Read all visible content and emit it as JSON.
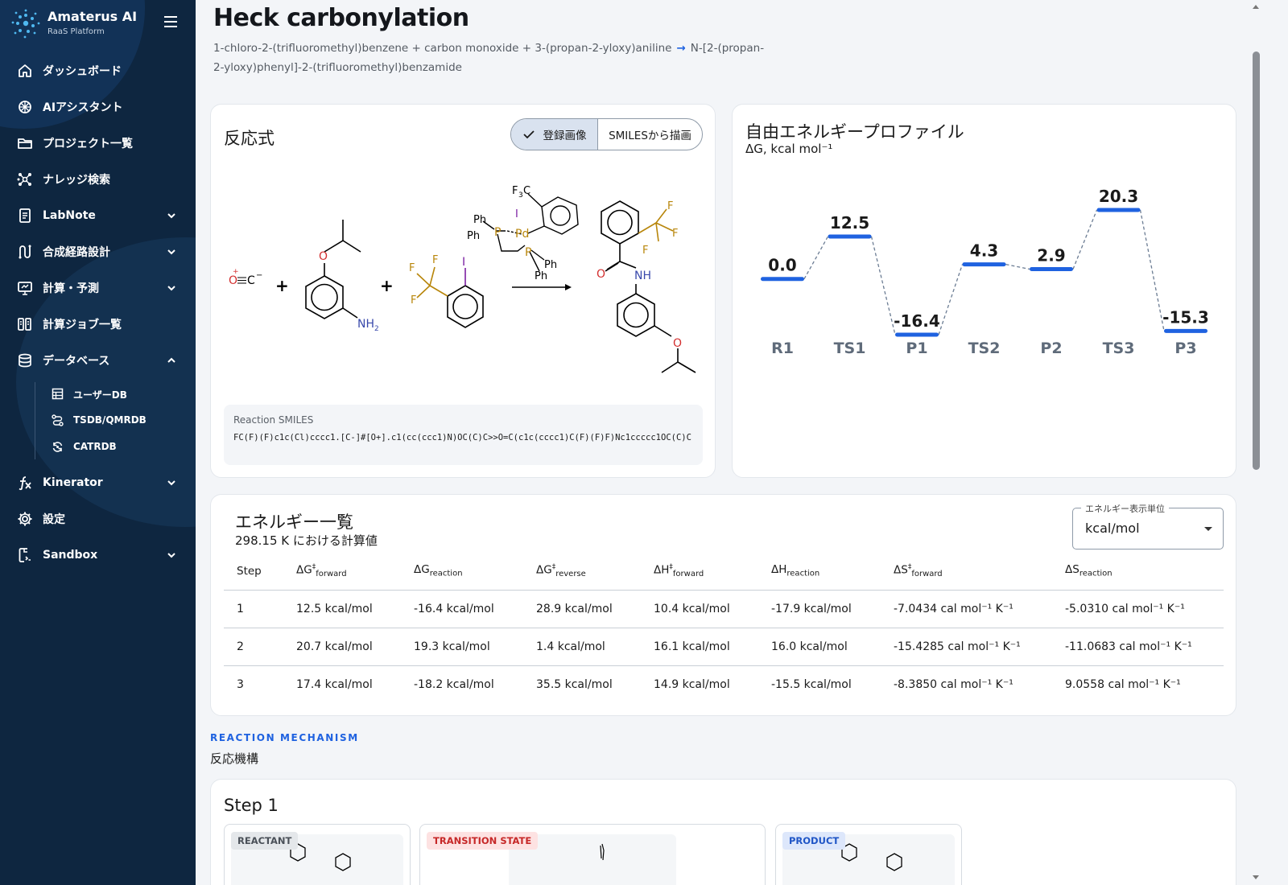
{
  "brand": {
    "name": "Amaterus AI",
    "subtitle": "RaaS Platform"
  },
  "sidebar": {
    "items": [
      {
        "label": "ダッシュボード",
        "icon": "home-icon"
      },
      {
        "label": "AIアシスタント",
        "icon": "ai-assistant-icon"
      },
      {
        "label": "プロジェクト一覧",
        "icon": "folder-icon"
      },
      {
        "label": "ナレッジ検索",
        "icon": "knowledge-graph-icon"
      },
      {
        "label": "LabNote",
        "icon": "notebook-icon",
        "expandable": true
      },
      {
        "label": "合成経路設計",
        "icon": "route-icon",
        "expandable": true
      },
      {
        "label": "計算・予測",
        "icon": "monitor-icon",
        "expandable": true
      },
      {
        "label": "計算ジョブ一覧",
        "icon": "jobs-icon"
      },
      {
        "label": "データベース",
        "icon": "database-icon",
        "expandable": true,
        "expanded": true
      },
      {
        "label": "Kinerator",
        "icon": "function-icon",
        "expandable": true
      },
      {
        "label": "設定",
        "icon": "gear-icon"
      },
      {
        "label": "Sandbox",
        "icon": "sandbox-icon",
        "expandable": true
      }
    ],
    "database_sub": [
      {
        "label": "ユーザーDB",
        "icon": "table-icon"
      },
      {
        "label": "TSDB/QMRDB",
        "icon": "path-icon"
      },
      {
        "label": "CATRDB",
        "icon": "cycle-icon"
      }
    ]
  },
  "header": {
    "title": "Heck carbonylation",
    "reactants": "1-chloro-2-(trifluoromethyl)benzene + carbon monoxide + 3-(propan-2-yloxy)aniline",
    "arrow": "→",
    "product": "N-[2-(propan-2-yloxy)phenyl]-2-(trifluoromethyl)benzamide"
  },
  "reaction_card": {
    "title": "反応式",
    "toggle": {
      "option_a": "登録画像",
      "option_b": "SMILESから描画",
      "selected": "登録画像"
    },
    "smiles_label": "Reaction SMILES",
    "smiles": "FC(F)(F)c1c(Cl)cccc1.[C-]#[O+].c1(cc(ccc1)N)OC(C)C>>O=C(c1c(cccc1)C(F)(F)F)Nc1ccccc1OC(C)C"
  },
  "profile_card": {
    "title": "自由エネルギープロファイル",
    "subtitle": "ΔG, kcal mol⁻¹"
  },
  "chart_data": {
    "type": "line",
    "categories": [
      "R1",
      "TS1",
      "P1",
      "TS2",
      "P2",
      "TS3",
      "P3"
    ],
    "values": [
      0.0,
      12.5,
      -16.4,
      4.3,
      2.9,
      20.3,
      -15.3
    ],
    "title": "自由エネルギープロファイル",
    "ylabel": "ΔG, kcal mol⁻¹",
    "ylim": [
      -16.4,
      20.3
    ],
    "grid": false,
    "color": "#1f62e0"
  },
  "energy_card": {
    "title": "エネルギー一覧",
    "subtitle": "298.15 K における計算値",
    "unit_select": {
      "legend": "エネルギー表示単位",
      "value": "kcal/mol"
    },
    "columns": [
      "Step",
      "ΔG‡forward",
      "ΔGreaction",
      "ΔG‡reverse",
      "ΔH‡forward",
      "ΔHreaction",
      "ΔS‡forward",
      "ΔSreaction"
    ],
    "rows": [
      {
        "step": "1",
        "dg_f": "12.5 kcal/mol",
        "dg_r": "-16.4 kcal/mol",
        "dg_rev": "28.9 kcal/mol",
        "dh_f": "10.4 kcal/mol",
        "dh_r": "-17.9 kcal/mol",
        "ds_f": "-7.0434",
        "ds_r": "-5.0310"
      },
      {
        "step": "2",
        "dg_f": "20.7 kcal/mol",
        "dg_r": "19.3 kcal/mol",
        "dg_rev": "1.4 kcal/mol",
        "dh_f": "16.1 kcal/mol",
        "dh_r": "16.0 kcal/mol",
        "ds_f": "-15.4285",
        "ds_r": "-11.0683"
      },
      {
        "step": "3",
        "dg_f": "17.4 kcal/mol",
        "dg_r": "-18.2 kcal/mol",
        "dg_rev": "35.5 kcal/mol",
        "dh_f": "14.9 kcal/mol",
        "dh_r": "-15.5 kcal/mol",
        "ds_f": "-8.3850",
        "ds_r": "9.0558"
      }
    ],
    "entropy_unit": "cal mol⁻¹ K⁻¹"
  },
  "mechanism": {
    "kicker": "REACTION MECHANISM",
    "title": "反応機構",
    "step_title": "Step 1",
    "tags": {
      "reactant": "REACTANT",
      "ts": "TRANSITION STATE",
      "product": "PRODUCT"
    }
  }
}
